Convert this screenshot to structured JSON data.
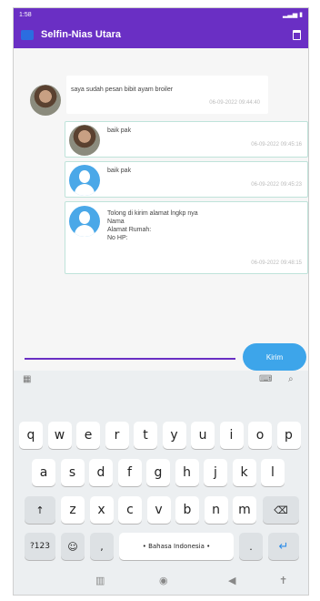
{
  "status": {
    "time": "1:58",
    "right": "▂▃▅ ▮"
  },
  "appbar": {
    "title": "Selfin-Nias Utara"
  },
  "messages": [
    {
      "text": "saya sudah pesan bibit ayam broiler",
      "time": "06-09-2022 09:44:40"
    },
    {
      "text": "baik pak",
      "time": "06-09-2022 09:45:16"
    },
    {
      "text": "baik pak",
      "time": "06-09-2022 09:45:23"
    },
    {
      "text": "Tolong di kirim alamat lngkp nya\nNama\nAlamat Rumah:\nNo HP:",
      "time": "06-09-2022 09:48:15"
    }
  ],
  "input": {
    "placeholder": "",
    "send_label": "Kirim"
  },
  "keyboard": {
    "row1": [
      "q",
      "w",
      "e",
      "r",
      "t",
      "y",
      "u",
      "i",
      "o",
      "p"
    ],
    "row2": [
      "a",
      "s",
      "d",
      "f",
      "g",
      "h",
      "j",
      "k",
      "l"
    ],
    "row3": [
      "z",
      "x",
      "c",
      "v",
      "b",
      "n",
      "m"
    ],
    "shift": "↑",
    "backspace": "⌫",
    "num": "?123",
    "emoji": "☺",
    "comma": ",",
    "space": "• Bahasa Indonesia •",
    "period": ".",
    "enter": "↵"
  },
  "nav": {
    "recent": "▥",
    "home": "◉",
    "back": "◀",
    "accessibility": "✝"
  }
}
